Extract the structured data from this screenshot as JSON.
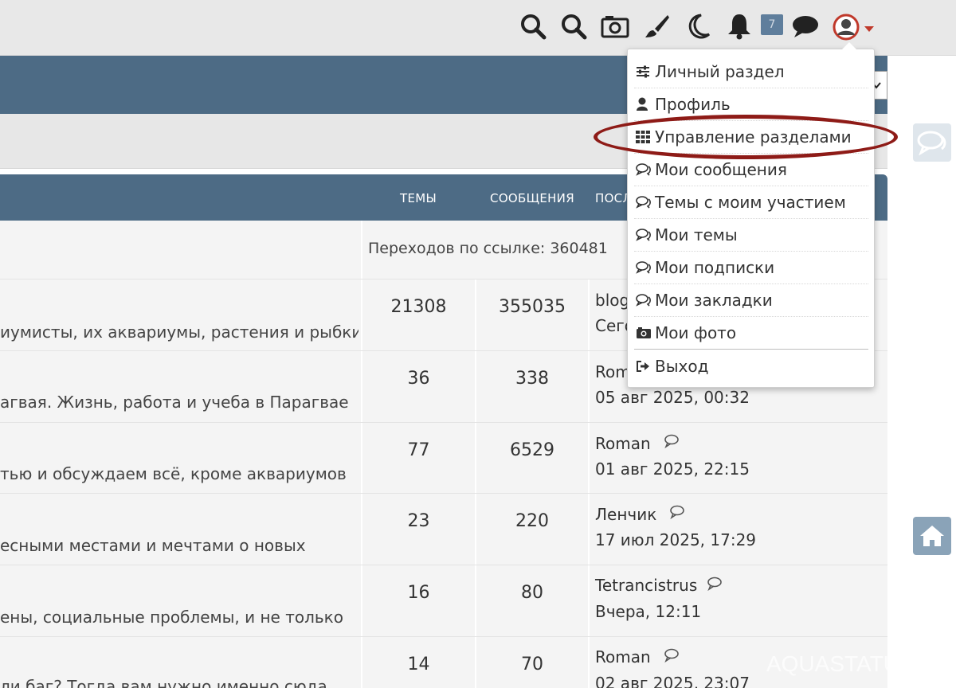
{
  "toolbar": {
    "icons": [
      "search-icon",
      "search-alt-icon",
      "camera-icon",
      "brush-icon",
      "moon-icon",
      "bell-icon",
      "chat-bubble-icon",
      "user-avatar-icon"
    ],
    "notification_count": "7",
    "accent_color": "#c0392b"
  },
  "table": {
    "headers": {
      "topics": "ТЕМЫ",
      "messages": "СООБЩЕНИЯ",
      "last": "ПОСЛ"
    },
    "transitions": "Переходов по ссылке: 360481",
    "rows": [
      {
        "desc": "иумисты, их аквариумы, растения и рыбки",
        "topics": "21308",
        "messages": "355035",
        "last_user": "blog",
        "last_date": "Сего"
      },
      {
        "desc": "агвая. Жизнь, работа и учеба в Парагвае",
        "topics": "36",
        "messages": "338",
        "last_user": "Rom",
        "last_date": "05 авг 2025, 00:32"
      },
      {
        "desc": "тью и обсуждаем всё, кроме аквариумов",
        "topics": "77",
        "messages": "6529",
        "last_user": "Roman",
        "last_date": "01 авг 2025, 22:15"
      },
      {
        "desc": "есными местами и мечтами о новых",
        "topics": "23",
        "messages": "220",
        "last_user": "Ленчик",
        "last_date": "17 июл 2025, 17:29"
      },
      {
        "desc": "ены, социальные проблемы, и не только",
        "topics": "16",
        "messages": "80",
        "last_user": "Tetrancistrus",
        "last_date": "Вчера, 12:11"
      },
      {
        "desc": "ли баг? Тогда вам нужно именно сюда",
        "topics": "14",
        "messages": "70",
        "last_user": "Roman",
        "last_date": "02 авг 2025, 23:07"
      }
    ]
  },
  "dropdown": {
    "items": [
      {
        "label": "Личный раздел",
        "icon": "sliders-icon"
      },
      {
        "label": "Профиль",
        "icon": "user-icon"
      },
      {
        "label": "Управление разделами",
        "icon": "grid-icon"
      },
      {
        "label": "Мои сообщения",
        "icon": "comments-icon"
      },
      {
        "label": "Темы с моим участием",
        "icon": "comments-icon"
      },
      {
        "label": "Мои темы",
        "icon": "comments-icon"
      },
      {
        "label": "Мои подписки",
        "icon": "comments-icon"
      },
      {
        "label": "Мои закладки",
        "icon": "comments-icon"
      },
      {
        "label": "Мои фото",
        "icon": "camera-icon"
      },
      {
        "label": "Выход",
        "icon": "sign-out-icon"
      }
    ]
  },
  "watermark": "AQUASTATU",
  "colors": {
    "header_blue": "#4d6b85",
    "highlight_red": "#8e1b17"
  }
}
